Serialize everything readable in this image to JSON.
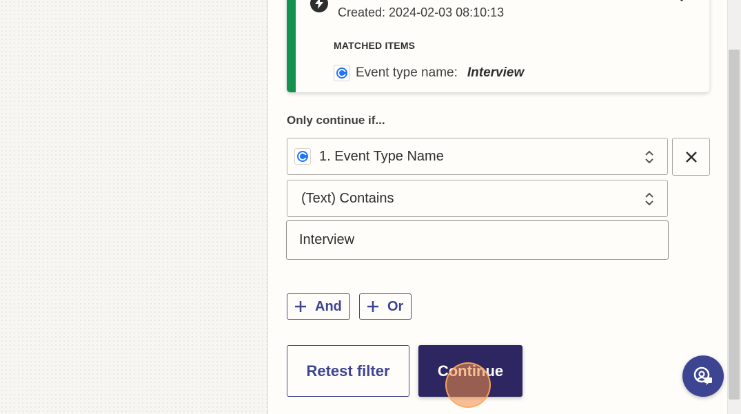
{
  "matched_card": {
    "created": "Created: 2024-02-03 08:10:13",
    "heading": "MATCHED ITEMS",
    "item_label": "Event type name:",
    "item_value": "Interview"
  },
  "filter": {
    "heading": "Only continue if...",
    "field_select": "1. Event Type Name",
    "condition_select": "(Text) Contains",
    "value_input": "Interview"
  },
  "logic_buttons": {
    "and_label": "And",
    "or_label": "Or"
  },
  "actions": {
    "retest_label": "Retest filter",
    "continue_label": "Continue"
  },
  "colors": {
    "accent_green": "#13914f",
    "primary": "#3d4592",
    "continue_bg": "#2d2660",
    "app_logo_blue": "#1f75fe"
  },
  "icons": [
    "bolt-icon",
    "close-icon",
    "app-logo-icon",
    "chevron-up-down-icon",
    "plus-icon",
    "help-icon"
  ]
}
